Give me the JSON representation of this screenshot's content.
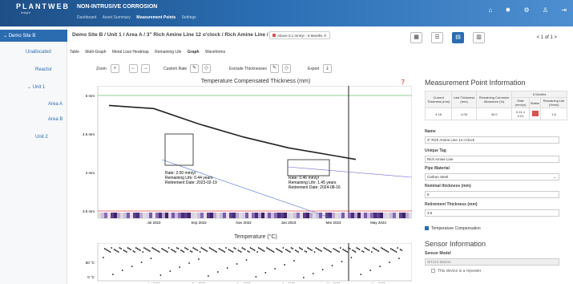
{
  "brand": {
    "logo": "PLANTWEB",
    "logo_sub": "Insight",
    "app_title": "NON-INTRUSIVE CORROSION"
  },
  "nav": {
    "tabs": [
      "Dashboard",
      "Asset Summary",
      "Measurement Points",
      "Settings"
    ],
    "active": "Measurement Points"
  },
  "top_icons": [
    "home-icon",
    "gear-icon",
    "settings-icon",
    "user-icon",
    "logout-icon"
  ],
  "sidebar": {
    "site": "Demo Site B",
    "items": [
      {
        "label": "Unallocated"
      },
      {
        "label": "Reactor"
      },
      {
        "label": "Unit 1"
      },
      {
        "label": "Area A"
      },
      {
        "label": "Area B"
      },
      {
        "label": "Unit 2"
      }
    ]
  },
  "breadcrumb": "Demo Site B / Unit 1 / Area A / 3\" Rich Amine Line 12 o'clock / Rich Amine Line / G0JM",
  "filter_chip": "Above 0.1 mm/yr - 6 Months",
  "tabs": [
    "Table",
    "Multi-Graph",
    "Metal Loss Heatmap",
    "Remaining Life",
    "Graph",
    "Waveforms"
  ],
  "active_tab": "Graph",
  "toolbar": {
    "zoom": "Zoom",
    "custom_rate": "Custom Rate",
    "exclude": "Exclude Thicknesses",
    "export": "Export"
  },
  "pager": "< 1 of 1 >",
  "charts": {
    "thickness_title": "Temperature Compensated Thickness (mm)",
    "temperature_title": "Temperature (°C)"
  },
  "chart_data": [
    {
      "type": "line",
      "title": "Temperature Compensated Thickness (mm)",
      "x_ticks": [
        "Jul 2022",
        "Sep 2022",
        "Nov 2022",
        "Jan 2023",
        "Mar 2023",
        "May 2023"
      ],
      "y_ticks": [
        "5 mm",
        "4.5 mm",
        "4 mm",
        "3.5 mm"
      ],
      "ylim": [
        3.5,
        5.0
      ],
      "series": [
        {
          "x": [
            "May 2022",
            "Jun 2022",
            "Jul 2022",
            "Sep 2022",
            "Nov 2022",
            "Jan 2023",
            "Feb 2023",
            "Mar 2023",
            "Apr 2023"
          ],
          "y": [
            4.87,
            4.85,
            4.83,
            4.63,
            4.46,
            4.32,
            4.27,
            4.22,
            4.17
          ]
        }
      ],
      "annotations": [
        {
          "rate": "Rate: 2.00 mm/yr",
          "life": "Remaining Life: 0.44 years",
          "retire": "Retirement Date: 2023-02-19"
        },
        {
          "rate": "Rate: 0.46 mm/yr",
          "life": "Remaining Life: 1.45 years",
          "retire": "Retirement Date: 2024-08-16"
        }
      ]
    },
    {
      "type": "scatter",
      "title": "Temperature (°C)",
      "x_ticks": [
        "Jul 2022",
        "Sep 2022",
        "Nov 2022",
        "Jan 2023",
        "Mar 2023",
        "May 2023"
      ],
      "y_ticks": [
        "50 °C",
        "0 °C"
      ]
    }
  ],
  "panel": {
    "title": "Measurement Point Information",
    "table": {
      "headers": [
        "Current Thickness (mm)",
        "Last Thickness (mm)",
        "Remaining Corrosion Allowance (%)",
        "Rate (mm/yr)",
        "Status",
        "Remaining Life (Years)"
      ],
      "group": "6 Months",
      "row": [
        "4.16",
        "4.05",
        "40.0",
        "0.41 ± 0.01",
        "",
        "1.6"
      ],
      "status_color": "#d9534f"
    },
    "fields": [
      {
        "label": "Name",
        "value": "3\" Rich Amine Line 12 o'clock"
      },
      {
        "label": "Unique Tag",
        "value": "Rich Amine Line"
      },
      {
        "label": "Pipe Material",
        "value": "Carbon Steel"
      },
      {
        "label": "Nominal thickness (mm)",
        "value": "5"
      },
      {
        "label": "Retirement Thickness (mm)",
        "value": "3.5"
      }
    ],
    "temp_comp": "Temperature Compensation",
    "sensor_title": "Sensor Information",
    "sensor_model_label": "Sensor Model",
    "sensor_model": "WT210 Marine",
    "repeater": "This device is a repeater"
  }
}
